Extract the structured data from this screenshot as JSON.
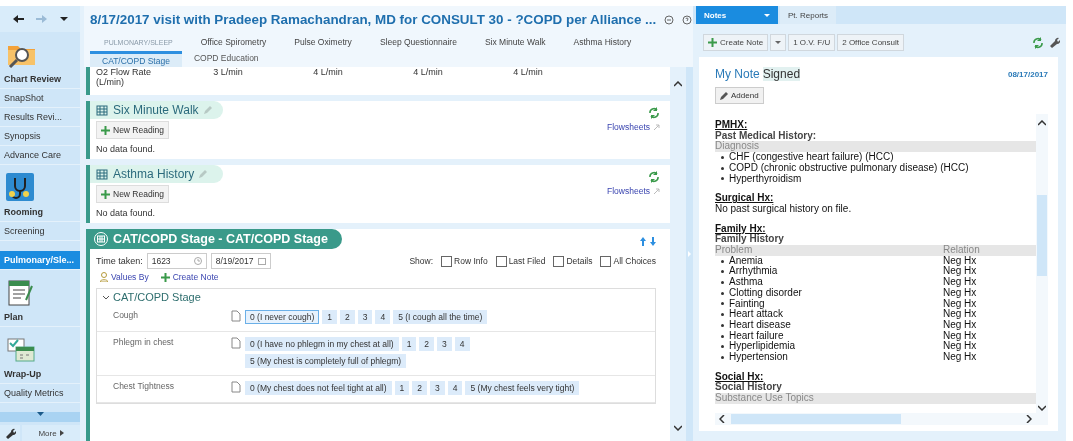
{
  "sidebar": {
    "items": [
      {
        "label": "Chart Review",
        "kind": "launcher",
        "selected": false
      },
      {
        "label": "SnapShot",
        "kind": "link",
        "selected": false
      },
      {
        "label": "Results Revi...",
        "kind": "link",
        "selected": false
      },
      {
        "label": "Synopsis",
        "kind": "link",
        "selected": false
      },
      {
        "label": "Advance Care",
        "kind": "link",
        "selected": false
      },
      {
        "label": "Rooming",
        "kind": "launcher",
        "selected": false
      },
      {
        "label": "Screening",
        "kind": "link",
        "selected": false
      },
      {
        "label": "Pulmonary/Sle...",
        "kind": "link",
        "selected": true
      },
      {
        "label": "Plan",
        "kind": "launcher",
        "selected": false
      },
      {
        "label": "Wrap-Up",
        "kind": "launcher",
        "selected": false
      },
      {
        "label": "Quality Metrics",
        "kind": "link",
        "selected": false
      }
    ],
    "more": "More"
  },
  "activity": {
    "title": "8/17/2017 visit with Pradeep Ramachandran, MD for CONSULT 30 - ?COPD per Alliance ...",
    "tabs": [
      {
        "label": "PULMONARY/SLEEP",
        "selected": true
      },
      {
        "label": "Office Spirometry",
        "selected": false
      },
      {
        "label": "Pulse Oximetry",
        "selected": false
      },
      {
        "label": "Sleep Questionnaire",
        "selected": false
      },
      {
        "label": "Six Minute Walk",
        "selected": false
      },
      {
        "label": "Asthma History",
        "selected": false
      }
    ],
    "subtabs": [
      {
        "label": "CAT/COPD Stage",
        "selected": true
      },
      {
        "label": "COPD Education",
        "selected": false
      }
    ],
    "flow_row": {
      "label": "O2 Flow Rate (L/min)",
      "values": [
        "3 L/min",
        "4 L/min",
        "4 L/min",
        "4 L/min"
      ]
    },
    "sections": [
      {
        "title": "Six Minute Walk",
        "button": "New Reading",
        "link": "Flowsheets",
        "empty": "No data found."
      },
      {
        "title": "Asthma History",
        "button": "New Reading",
        "link": "Flowsheets",
        "empty": "No data found."
      }
    ],
    "stage": {
      "title": "CAT/COPD Stage - CAT/COPD Stage",
      "time_label": "Time taken:",
      "time": "1623",
      "date": "8/19/2017",
      "show_label": "Show:",
      "show": [
        {
          "label": "Row Info",
          "checked": false
        },
        {
          "label": "Last Filed",
          "checked": false
        },
        {
          "label": "Details",
          "checked": false
        },
        {
          "label": "All Choices",
          "checked": false
        }
      ],
      "values_by": "Values By",
      "create_note": "Create Note",
      "group": {
        "title": "CAT/COPD Stage",
        "expanded": true
      },
      "questions": [
        {
          "label": "Cough",
          "options": [
            {
              "label": "0 (I never cough)",
              "selected": true
            },
            {
              "label": "1",
              "selected": false
            },
            {
              "label": "2",
              "selected": false
            },
            {
              "label": "3",
              "selected": false
            },
            {
              "label": "4",
              "selected": false
            },
            {
              "label": "5 (I cough all the time)",
              "selected": false
            }
          ]
        },
        {
          "label": "Phlegm in chest",
          "options": [
            {
              "label": "0 (I have no phlegm in my chest at all)",
              "selected": false
            },
            {
              "label": "1",
              "selected": false
            },
            {
              "label": "2",
              "selected": false
            },
            {
              "label": "3",
              "selected": false
            },
            {
              "label": "4",
              "selected": false
            },
            {
              "label": "5 (My chest is completely full of phlegm)",
              "selected": false
            }
          ]
        },
        {
          "label": "Chest Tightness",
          "options": [
            {
              "label": "0 (My chest does not feel tight at all)",
              "selected": false
            },
            {
              "label": "1",
              "selected": false
            },
            {
              "label": "2",
              "selected": false
            },
            {
              "label": "3",
              "selected": false
            },
            {
              "label": "4",
              "selected": false
            },
            {
              "label": "5 (My chest feels very tight)",
              "selected": false
            }
          ]
        }
      ]
    }
  },
  "notes": {
    "tabs": [
      {
        "label": "Notes",
        "selected": true
      },
      {
        "label": "Pt. Reports",
        "selected": false
      }
    ],
    "toolbar": {
      "create": "Create Note",
      "templates": [
        "1 O.V. F/U",
        "2 Office Consult"
      ]
    },
    "note": {
      "title": "My Note",
      "status": "Signed",
      "date": "08/17/2017",
      "addend": "Addend",
      "sections": [
        {
          "heading": "PMHX:",
          "blocks": [
            {
              "kind": "subheading",
              "cells": [
                "Past Medical History:"
              ]
            },
            {
              "kind": "header",
              "cells": [
                "Diagnosis"
              ]
            },
            {
              "kind": "bullet",
              "cells": [
                "CHF (congestive heart failure) (HCC)"
              ]
            },
            {
              "kind": "bullet",
              "cells": [
                "COPD (chronic obstructive pulmonary disease) (HCC)"
              ]
            },
            {
              "kind": "bullet",
              "cells": [
                "Hyperthyroidism"
              ]
            }
          ]
        },
        {
          "heading": "Surgical Hx:",
          "blocks": [
            {
              "kind": "text",
              "cells": [
                "No past surgical history on file."
              ]
            }
          ]
        },
        {
          "heading": "Family Hx:",
          "blocks": [
            {
              "kind": "subheading",
              "cells": [
                "Family History"
              ]
            },
            {
              "kind": "header",
              "cells": [
                "Problem",
                "Relation"
              ]
            },
            {
              "kind": "bullet",
              "cells": [
                "Anemia",
                "Neg Hx"
              ]
            },
            {
              "kind": "bullet",
              "cells": [
                "Arrhythmia",
                "Neg Hx"
              ]
            },
            {
              "kind": "bullet",
              "cells": [
                "Asthma",
                "Neg Hx"
              ]
            },
            {
              "kind": "bullet",
              "cells": [
                "Clotting disorder",
                "Neg Hx"
              ]
            },
            {
              "kind": "bullet",
              "cells": [
                "Fainting",
                "Neg Hx"
              ]
            },
            {
              "kind": "bullet",
              "cells": [
                "Heart attack",
                "Neg Hx"
              ]
            },
            {
              "kind": "bullet",
              "cells": [
                "Heart disease",
                "Neg Hx"
              ]
            },
            {
              "kind": "bullet",
              "cells": [
                "Heart failure",
                "Neg Hx"
              ]
            },
            {
              "kind": "bullet",
              "cells": [
                "Hyperlipidemia",
                "Neg Hx"
              ]
            },
            {
              "kind": "bullet",
              "cells": [
                "Hypertension",
                "Neg Hx"
              ]
            }
          ]
        },
        {
          "heading": "Social Hx:",
          "blocks": [
            {
              "kind": "subheading",
              "cells": [
                "Social History"
              ]
            },
            {
              "kind": "header",
              "cells": [
                "Substance Use Topics"
              ]
            }
          ]
        }
      ]
    }
  }
}
